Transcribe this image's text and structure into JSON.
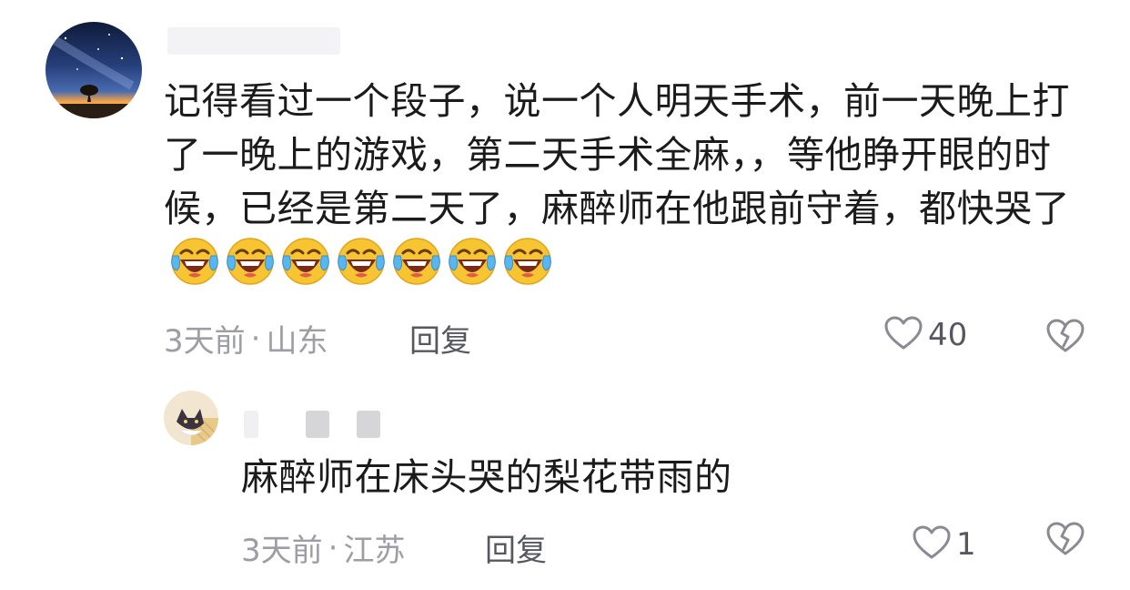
{
  "comment": {
    "text": "记得看过一个段子，说一个人明天手术，前一天晚上打了一晚上的游戏，第二天手术全麻，，等他睁开眼的时候，已经是第二天了，麻醉师在他跟前守着，都快哭了",
    "emoji_icon": "laughing-tears-emoji",
    "emoji_count": 7,
    "time": "3天前",
    "separator": "·",
    "location": "山东",
    "reply_label": "回复",
    "like_count": "40"
  },
  "reply": {
    "text": "麻醉师在床头哭的梨花带雨的",
    "time": "3天前",
    "separator": "·",
    "location": "江苏",
    "reply_label": "回复",
    "like_count": "1"
  },
  "colors": {
    "text": "#1b1b1b",
    "meta": "#9d9da4",
    "action": "#575760",
    "icon_stroke": "#8a8a92",
    "emoji_face": "#f7c531"
  }
}
